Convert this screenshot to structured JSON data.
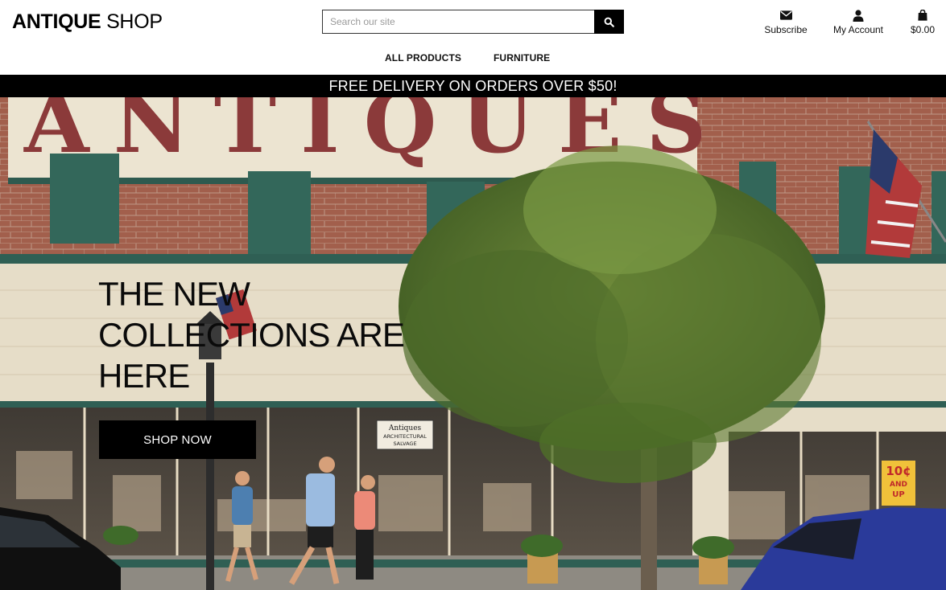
{
  "header": {
    "logo": {
      "bold": "ANTIQUE",
      "light": "SHOP"
    },
    "search": {
      "placeholder": "Search our site",
      "value": "",
      "button_icon": "search-icon"
    },
    "links": [
      {
        "label": "Subscribe",
        "icon": "envelope-icon"
      },
      {
        "label": "My Account",
        "icon": "user-icon"
      },
      {
        "label": "$0.00",
        "icon": "shopping-bag-icon"
      }
    ]
  },
  "nav": {
    "items": [
      {
        "label": "ALL PRODUCTS"
      },
      {
        "label": "FURNITURE"
      }
    ]
  },
  "banner": {
    "text": "FREE DELIVERY ON ORDERS OVER $50!"
  },
  "hero": {
    "title_lines": [
      "THE NEW",
      "COLLECTIONS ARE",
      "HERE"
    ],
    "cta_label": "SHOP NOW",
    "photo_sign_text": "ANTIQUES",
    "store_sign": {
      "line1": "Antiques",
      "line2": "ARCHITECTURAL",
      "line3": "SALVAGE"
    },
    "window_sign": {
      "line1": "10¢",
      "line2": "AND",
      "line3": "UP"
    }
  },
  "colors": {
    "header_bg": "#ffffff",
    "banner_bg": "#000000",
    "banner_text": "#ffffff",
    "cta_bg": "#000000",
    "cta_text": "#ffffff",
    "brick": "#a8624f",
    "sign_letters": "#8b3a3a",
    "trim_green": "#2e5a4f",
    "stucco": "#e6ddc8"
  }
}
